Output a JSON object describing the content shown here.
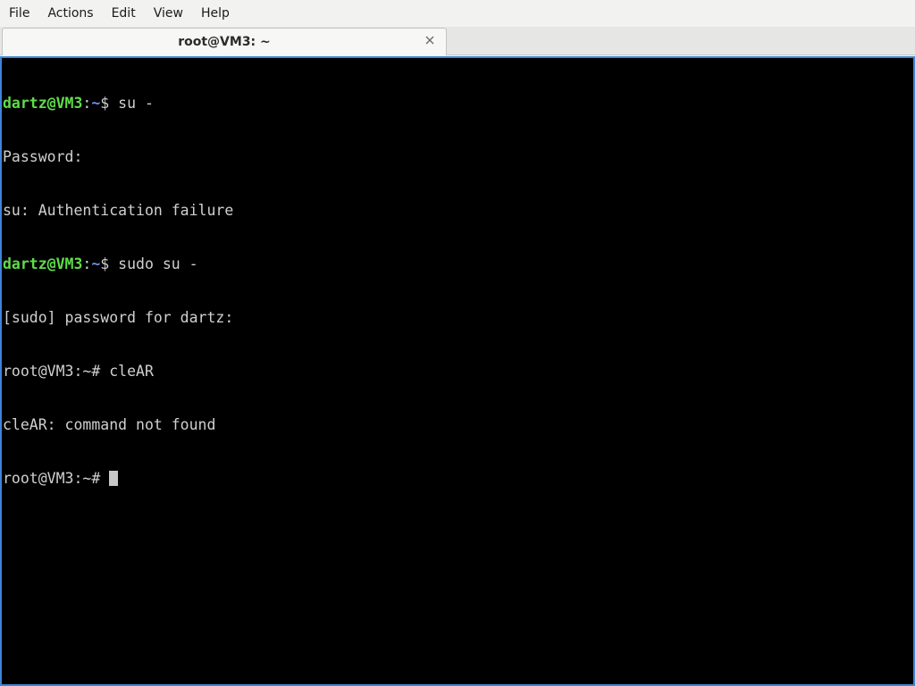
{
  "menu": {
    "items": [
      "File",
      "Actions",
      "Edit",
      "View",
      "Help"
    ]
  },
  "tabs": [
    {
      "title": "root@VM3: ~",
      "active": true
    }
  ],
  "terminal": {
    "lines": [
      {
        "type": "user_prompt",
        "user_host": "dartz@VM3",
        "sep": ":",
        "path": "~",
        "symbol": "$ ",
        "text": "su -"
      },
      {
        "type": "output",
        "text": "Password:"
      },
      {
        "type": "output",
        "text": "su: Authentication failure"
      },
      {
        "type": "user_prompt",
        "user_host": "dartz@VM3",
        "sep": ":",
        "path": "~",
        "symbol": "$ ",
        "text": "sudo su -"
      },
      {
        "type": "output",
        "text": "[sudo] password for dartz:"
      },
      {
        "type": "output",
        "text": "root@VM3:~# cleAR"
      },
      {
        "type": "output",
        "text": "cleAR: command not found"
      },
      {
        "type": "output",
        "text": "root@VM3:~# "
      }
    ]
  },
  "colors": {
    "terminal_bg": "#000000",
    "terminal_fg": "#d0d0d0",
    "prompt_user": "#5fdc4a",
    "prompt_path": "#6f8fe6",
    "focus_border": "#3d86d6"
  }
}
